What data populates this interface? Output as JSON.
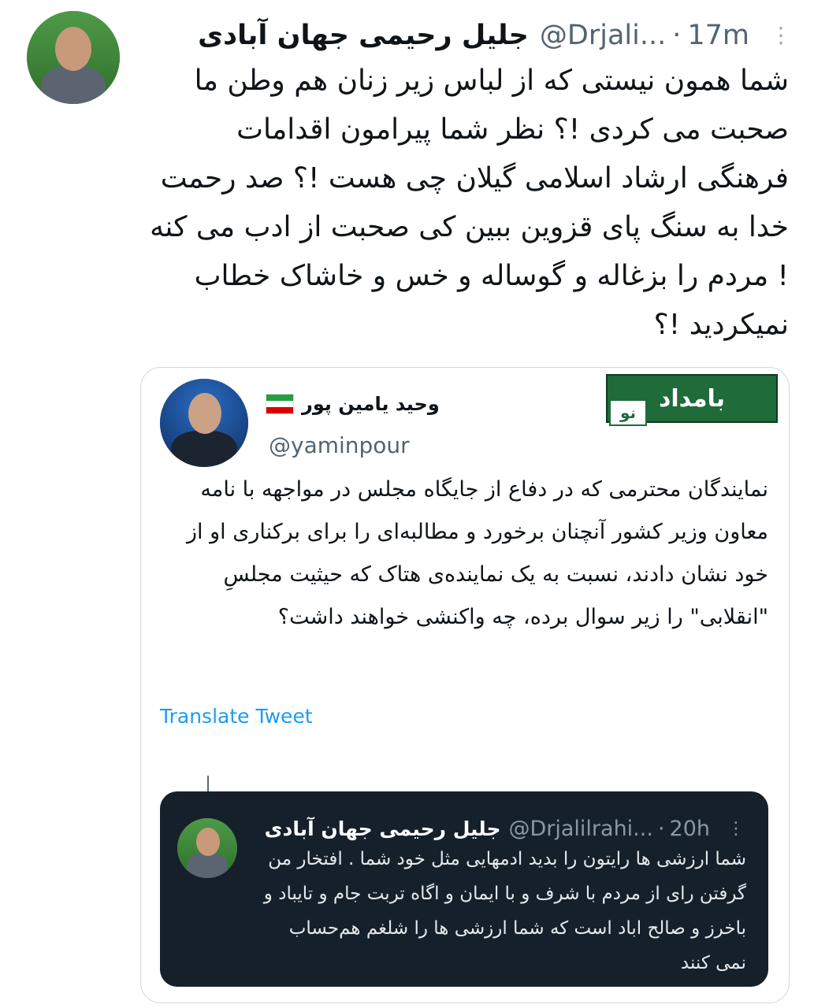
{
  "tweet": {
    "author_name": "جلیل رحیمی جهان آبادی",
    "handle": "@Drjali...",
    "separator": "·",
    "time": "17m",
    "more_icon": "⋮",
    "text": "شما همون نیستی که از لباس زیر زنان هم وطن ما صحبت می کردی !؟ نظر شما پیرامون اقدامات فرهنگی ارشاد اسلامی گیلان چی هست !؟ صد رحمت خدا به سنگ پای قزوین ببین کی صحبت از ادب می کنه ! مردم را بزغاله و گوساله و خس و خاشاک خطاب نمیکردید !؟"
  },
  "quoted": {
    "author_name": "وحید یامین پور",
    "handle": "@yaminpour",
    "logo_text": "بامداد",
    "logo_tail": "نو",
    "text": "نمایندگان محترمی که در دفاع از جایگاه مجلس در مواجهه با نامه معاون وزیر کشور آنچنان برخورد و مطالبه‌ای را برای برکناری او از خود نشان دادند، نسبت به یک نماینده‌ی هتاک که حیثیت مجلسِ \"انقلابی\" را زیر سوال برده، چه واکنشی خواهند داشت؟",
    "translate_label": "Translate Tweet"
  },
  "nested": {
    "author_name": "جلیل رحیمی جهان آبادی",
    "handle": "@Drjalilrahi...",
    "separator": "·",
    "time": "20h",
    "more_icon": "⋮",
    "text": "شما ارزشی ها رایتون را بدید ادمهایی مثل خود شما . افتخار من گرفتن رای از مردم با شرف و با ایمان و اگاه تربت جام و تایباد و باخرز و صالح اباد است که شما ارزشی ها را شلغم هم‌حساب نمی کنند"
  },
  "colors": {
    "link": "#1d9bf0",
    "dark_card_bg": "#15202b",
    "logo_green": "#1f6b3a"
  }
}
